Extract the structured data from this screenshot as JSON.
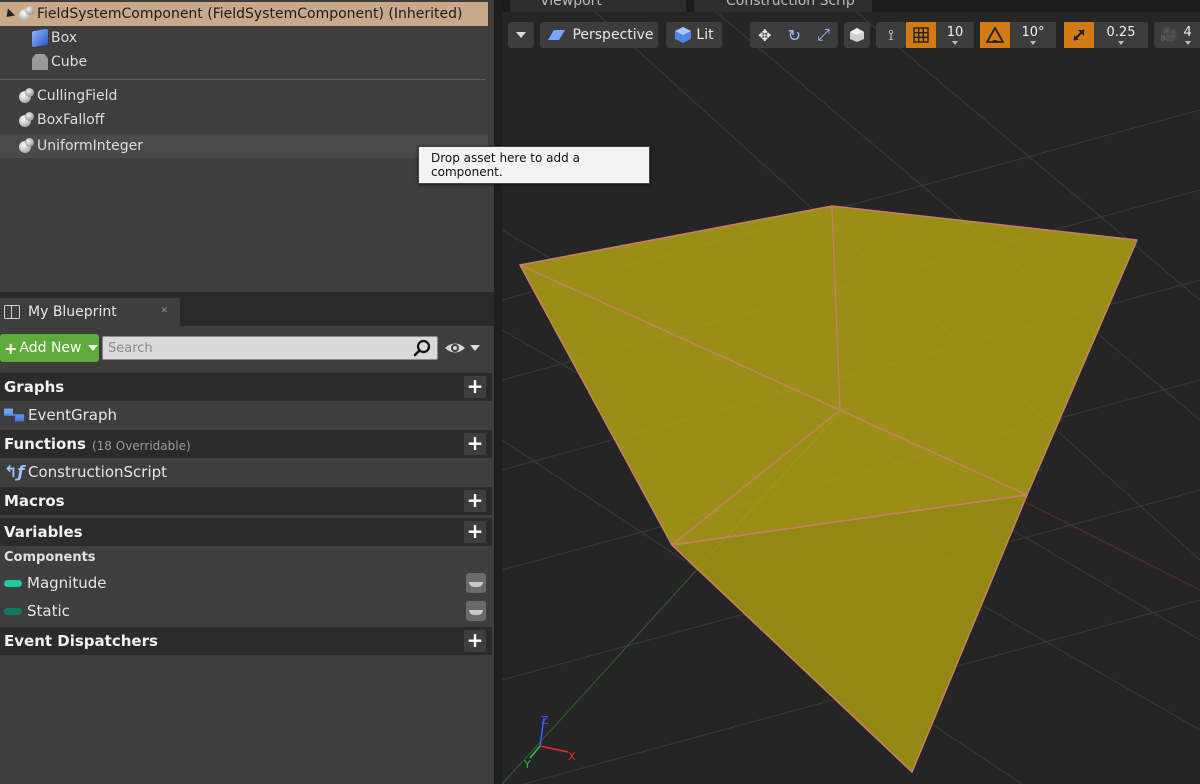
{
  "components": {
    "root": {
      "label": "FieldSystemComponent (FieldSystemComponent) (Inherited)"
    },
    "children": [
      {
        "label": "Box",
        "icon": "box-icon"
      },
      {
        "label": "Cube",
        "icon": "cube-icon"
      }
    ],
    "fields": [
      {
        "label": "CullingField",
        "icon": "field-icon"
      },
      {
        "label": "BoxFalloff",
        "icon": "field-icon"
      },
      {
        "label": "UniformInteger",
        "icon": "field-icon"
      }
    ],
    "tooltip": "Drop asset here to add a component."
  },
  "my_blueprint": {
    "tab_label": "My Blueprint",
    "add_new_label": "Add New",
    "search_placeholder": "Search",
    "sections": {
      "graphs": {
        "label": "Graphs",
        "items": [
          {
            "label": "EventGraph"
          }
        ]
      },
      "functions": {
        "label": "Functions",
        "sub": "(18 Overridable)",
        "items": [
          {
            "label": "ConstructionScript"
          }
        ]
      },
      "macros": {
        "label": "Macros"
      },
      "variables": {
        "label": "Variables",
        "subsection": "Components",
        "items": [
          {
            "label": "Magnitude",
            "color": "#1ec9a0"
          },
          {
            "label": "Static",
            "color": "#0f7a60"
          }
        ]
      },
      "event_dispatchers": {
        "label": "Event Dispatchers"
      }
    }
  },
  "viewport": {
    "tabs": [
      {
        "label": "Viewport"
      },
      {
        "label": "Construction Scrip"
      }
    ],
    "toolbar": {
      "perspective_label": "Perspective",
      "lit_label": "Lit",
      "grid_snap_value": "10",
      "rotation_snap_value": "10°",
      "scale_snap_value": "0.25",
      "camera_speed_value": "4"
    },
    "gizmo": {
      "z_label": "Z",
      "y_label": "Y",
      "x_label": "X"
    },
    "colors": {
      "box_fill": "#b5a614",
      "box_edge": "#c97f6b",
      "accent_orange": "#d27a14"
    }
  }
}
